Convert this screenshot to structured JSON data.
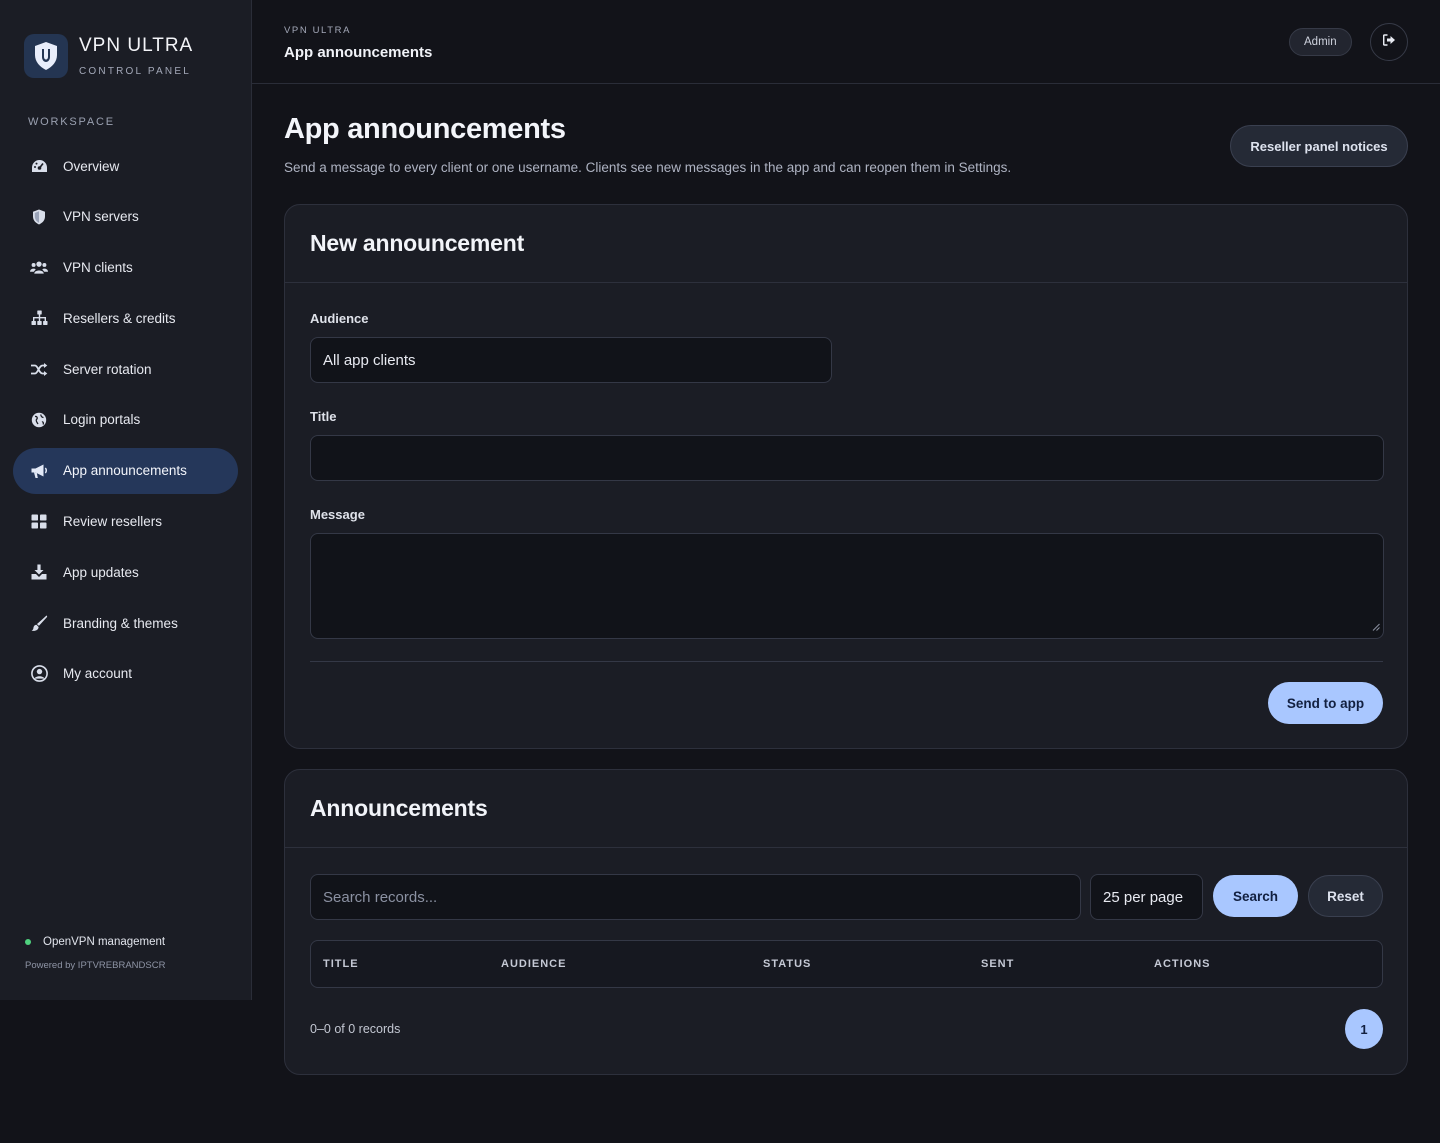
{
  "brand": {
    "name": "VPN ULTRA",
    "subtitle": "CONTROL PANEL"
  },
  "sidebar": {
    "section_label": "WORKSPACE",
    "items": [
      {
        "label": "Overview",
        "icon": "dashboard-gauge-icon"
      },
      {
        "label": "VPN servers",
        "icon": "shield-icon"
      },
      {
        "label": "VPN clients",
        "icon": "users-icon"
      },
      {
        "label": "Resellers & credits",
        "icon": "sitemap-icon"
      },
      {
        "label": "Server rotation",
        "icon": "shuffle-icon"
      },
      {
        "label": "Login portals",
        "icon": "globe-icon"
      },
      {
        "label": "App announcements",
        "icon": "megaphone-icon",
        "active": true
      },
      {
        "label": "Review resellers",
        "icon": "grid-icon"
      },
      {
        "label": "App updates",
        "icon": "download-icon"
      },
      {
        "label": "Branding & themes",
        "icon": "paint-brush-icon"
      },
      {
        "label": "My account",
        "icon": "user-circle-icon"
      }
    ],
    "footer": {
      "status": "OpenVPN management",
      "powered_by": "Powered by IPTVREBRANDSCR"
    }
  },
  "topbar": {
    "breadcrumb_small": "VPN ULTRA",
    "breadcrumb_title": "App announcements",
    "role_badge": "Admin",
    "logout_icon": "sign-out-icon"
  },
  "page": {
    "title": "App announcements",
    "description": "Send a message to every client or one username. Clients see new messages in the app and can reopen them in Settings.",
    "reseller_button": "Reseller panel notices"
  },
  "new_announcement": {
    "heading": "New announcement",
    "audience_label": "Audience",
    "audience_value": "All app clients",
    "title_label": "Title",
    "title_value": "",
    "message_label": "Message",
    "message_value": "",
    "send_button": "Send to app"
  },
  "announcements": {
    "heading": "Announcements",
    "search_placeholder": "Search records...",
    "per_page": "25 per page",
    "search_button": "Search",
    "reset_button": "Reset",
    "columns": [
      "TITLE",
      "AUDIENCE",
      "STATUS",
      "SENT",
      "ACTIONS"
    ],
    "rows": [],
    "records_text": "0–0 of 0 records",
    "current_page": "1"
  },
  "colors": {
    "accent": "#a9c7ff",
    "active_nav": "#25375a",
    "status_dot": "#4fd17e",
    "background": "#121319",
    "card": "#1b1d25"
  }
}
